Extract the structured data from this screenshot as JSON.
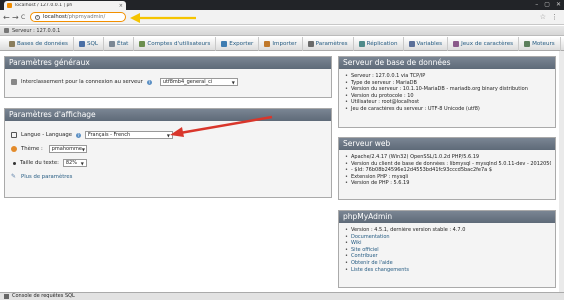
{
  "browser": {
    "tab_title": "localhost / 127.0.0.1 | ph",
    "tab_close": "×",
    "window_controls": [
      "–",
      "▢",
      "✕"
    ],
    "url_host": "localhost",
    "url_path": "/phpmyadmin/",
    "back_icon": "←",
    "forward_icon": "→",
    "reload_icon": "C",
    "star_icon": "☆",
    "menu_icon": "⋮"
  },
  "server_bar": {
    "label": "Serveur : 127.0.0.1"
  },
  "menu": [
    {
      "label": "Bases de données",
      "color": "#8a7d5c"
    },
    {
      "label": "SQL",
      "color": "#4a6fa5"
    },
    {
      "label": "État",
      "color": "#7b8794"
    },
    {
      "label": "Comptes d'utilisateurs",
      "color": "#6b8e4e"
    },
    {
      "label": "Exporter",
      "color": "#3e7cb1"
    },
    {
      "label": "Importer",
      "color": "#c0782a"
    },
    {
      "label": "Paramètres",
      "color": "#6a6a6a"
    },
    {
      "label": "Réplication",
      "color": "#4e8a8a"
    },
    {
      "label": "Variables",
      "color": "#5a6f99"
    },
    {
      "label": "Jeux de caractères",
      "color": "#8a5a8a"
    },
    {
      "label": "Moteurs",
      "color": "#5c7f5c"
    }
  ],
  "general": {
    "title": "Paramètres généraux",
    "collation_label": "Interclassement pour la connexion au serveur",
    "collation_value": "utf8mb4_general_ci"
  },
  "display": {
    "title": "Paramètres d'affichage",
    "language_label": "Langue - Language",
    "language_value": "Français - French",
    "theme_label": "Thème :",
    "theme_value": "pmahomme",
    "fontsize_label": "Taille du texte:",
    "fontsize_value": "82%",
    "more_link": "Plus de paramètres"
  },
  "db_server": {
    "title": "Serveur de base de données",
    "items": [
      "Serveur : 127.0.0.1 via TCP/IP",
      "Type de serveur : MariaDB",
      "Version du serveur : 10.1.10-MariaDB - mariadb.org binary distribution",
      "Version du protocole : 10",
      "Utilisateur : root@localhost",
      "Jeu de caractères du serveur : UTF-8 Unicode (utf8)"
    ]
  },
  "web_server": {
    "title": "Serveur web",
    "items": [
      "Apache/2.4.17 (Win32) OpenSSL/1.0.2d PHP/5.6.19",
      "Version du client de base de données : libmysql - mysqlnd 5.0.11-dev - 20120503",
      "- $Id: 76b08b24596e12d4553bd41fc93cccd5bac2fe7a $",
      "Extension PHP : mysqli",
      "Version de PHP : 5.6.19"
    ]
  },
  "pma": {
    "title": "phpMyAdmin",
    "items": [
      "Version : 4.5.1, dernière version stable : 4.7.0",
      "Documentation",
      "Wiki",
      "Site officiel",
      "Contribuer",
      "Obtenir de l'aide",
      "Liste des changements"
    ]
  },
  "console": {
    "label": "Console de requêtes SQL"
  },
  "colors": {
    "annotation_red": "#d9362b",
    "annotation_yellow": "#f5c400",
    "omnibox_border": "#f29000"
  }
}
